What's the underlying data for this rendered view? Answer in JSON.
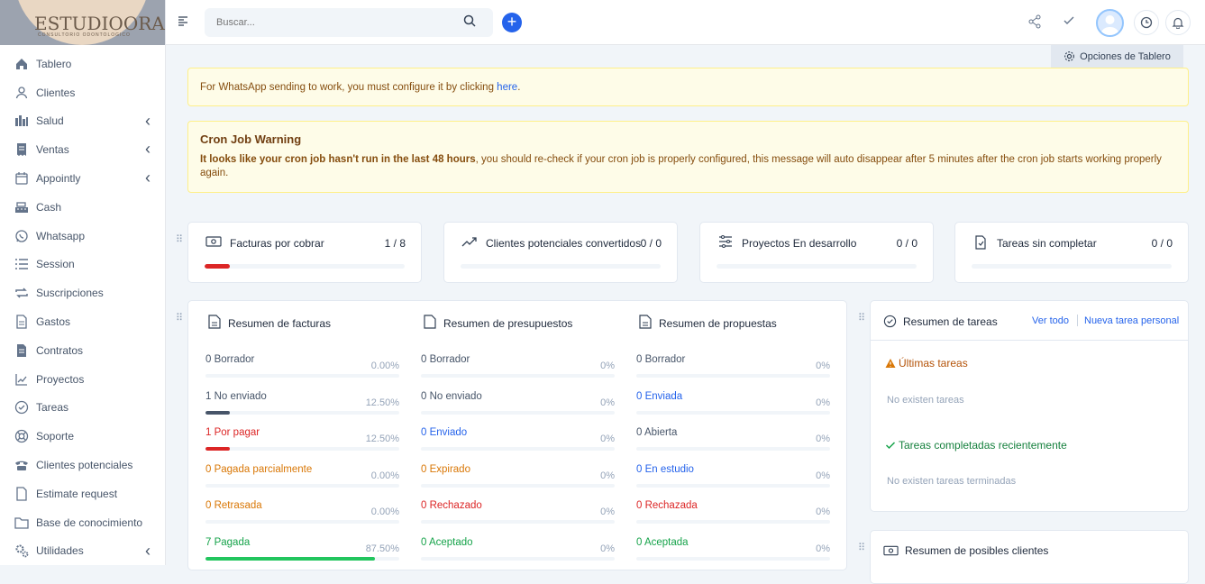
{
  "brand": {
    "logo_text": "ESTUDIOORAL",
    "logo_sub": "CONSULTORIO ODONTOLOGICO"
  },
  "sidebar": {
    "items": [
      {
        "label": "Tablero",
        "icon": "home-icon",
        "chev": false
      },
      {
        "label": "Clientes",
        "icon": "user-icon",
        "chev": false
      },
      {
        "label": "Salud",
        "icon": "chart-icon",
        "chev": true
      },
      {
        "label": "Ventas",
        "icon": "receipt-icon",
        "chev": true
      },
      {
        "label": "Appointly",
        "icon": "calendar-icon",
        "chev": true
      },
      {
        "label": "Cash",
        "icon": "register-icon",
        "chev": false
      },
      {
        "label": "Whatsapp",
        "icon": "whatsapp-icon",
        "chev": false
      },
      {
        "label": "Session",
        "icon": "list-icon",
        "chev": false
      },
      {
        "label": "Suscripciones",
        "icon": "repeat-icon",
        "chev": false
      },
      {
        "label": "Gastos",
        "icon": "file-icon",
        "chev": false
      },
      {
        "label": "Contratos",
        "icon": "contract-icon",
        "chev": false
      },
      {
        "label": "Proyectos",
        "icon": "chart-line-icon",
        "chev": false
      },
      {
        "label": "Tareas",
        "icon": "check-circle-icon",
        "chev": false
      },
      {
        "label": "Soporte",
        "icon": "lifebuoy-icon",
        "chev": false
      },
      {
        "label": "Clientes potenciales",
        "icon": "phone-icon",
        "chev": false
      },
      {
        "label": "Estimate request",
        "icon": "document-icon",
        "chev": false
      },
      {
        "label": "Base de conocimiento",
        "icon": "folder-icon",
        "chev": false
      },
      {
        "label": "Utilidades",
        "icon": "cogs-icon",
        "chev": true
      }
    ]
  },
  "topbar": {
    "search_placeholder": "Buscar..."
  },
  "dashboard_options": "Opciones de Tablero",
  "whatsapp_alert": {
    "text": "For WhatsApp sending to work, you must configure it by clicking ",
    "link": "here",
    "end": "."
  },
  "cron_alert": {
    "title": "Cron Job Warning",
    "bold": "It looks like your cron job hasn't run in the last 48 hours",
    "text": ", you should re-check if your cron job is properly configured, this message will auto disappear after 5 minutes after the cron job starts working properly again."
  },
  "stats": [
    {
      "title": "Facturas por cobrar",
      "value": "1 / 8",
      "progress": 0.125,
      "color": "#dc2626"
    },
    {
      "title": "Clientes potenciales convertidos",
      "value": "0 / 0",
      "progress": 0,
      "color": "#2563eb"
    },
    {
      "title": "Proyectos En desarrollo",
      "value": "0 / 0",
      "progress": 0,
      "color": "#2563eb"
    },
    {
      "title": "Tareas sin completar",
      "value": "0 / 0",
      "progress": 0,
      "color": "#2563eb"
    }
  ],
  "summaries": [
    {
      "title": "Resumen de facturas",
      "rows": [
        {
          "label": "0 Borrador",
          "pct": "0.00%",
          "color": "#475569",
          "progress": 0,
          "fill": "#475569"
        },
        {
          "label": "1 No enviado",
          "pct": "12.50%",
          "color": "#475569",
          "progress": 0.125,
          "fill": "#475569"
        },
        {
          "label": "1 Por pagar",
          "pct": "12.50%",
          "color": "#dc2626",
          "progress": 0.125,
          "fill": "#dc2626"
        },
        {
          "label": "0 Pagada parcialmente",
          "pct": "0.00%",
          "color": "#d97706",
          "progress": 0,
          "fill": "#d97706"
        },
        {
          "label": "0 Retrasada",
          "pct": "0.00%",
          "color": "#d97706",
          "progress": 0,
          "fill": "#d97706"
        },
        {
          "label": "7 Pagada",
          "pct": "87.50%",
          "color": "#16a34a",
          "progress": 0.875,
          "fill": "#22c55e"
        }
      ]
    },
    {
      "title": "Resumen de presupuestos",
      "rows": [
        {
          "label": "0 Borrador",
          "pct": "0%",
          "color": "#475569",
          "progress": 0,
          "fill": "#475569"
        },
        {
          "label": "0 No enviado",
          "pct": "0%",
          "color": "#475569",
          "progress": 0,
          "fill": "#475569"
        },
        {
          "label": "0 Enviado",
          "pct": "0%",
          "color": "#2563eb",
          "progress": 0,
          "fill": "#2563eb"
        },
        {
          "label": "0 Expirado",
          "pct": "0%",
          "color": "#d97706",
          "progress": 0,
          "fill": "#d97706"
        },
        {
          "label": "0 Rechazado",
          "pct": "0%",
          "color": "#dc2626",
          "progress": 0,
          "fill": "#dc2626"
        },
        {
          "label": "0 Aceptado",
          "pct": "0%",
          "color": "#16a34a",
          "progress": 0,
          "fill": "#16a34a"
        }
      ]
    },
    {
      "title": "Resumen de propuestas",
      "rows": [
        {
          "label": "0 Borrador",
          "pct": "0%",
          "color": "#475569",
          "progress": 0,
          "fill": "#475569"
        },
        {
          "label": "0 Enviada",
          "pct": "0%",
          "color": "#2563eb",
          "progress": 0,
          "fill": "#2563eb"
        },
        {
          "label": "0 Abierta",
          "pct": "0%",
          "color": "#475569",
          "progress": 0,
          "fill": "#475569"
        },
        {
          "label": "0 En estudio",
          "pct": "0%",
          "color": "#2563eb",
          "progress": 0,
          "fill": "#2563eb"
        },
        {
          "label": "0 Rechazada",
          "pct": "0%",
          "color": "#dc2626",
          "progress": 0,
          "fill": "#dc2626"
        },
        {
          "label": "0 Aceptada",
          "pct": "0%",
          "color": "#16a34a",
          "progress": 0,
          "fill": "#16a34a"
        }
      ]
    }
  ],
  "tasks": {
    "title": "Resumen de tareas",
    "view_all": "Ver todo",
    "new_task": "Nueva tarea personal",
    "latest": "Últimas tareas",
    "no_tasks": "No existen tareas",
    "completed": "Tareas completadas recientemente",
    "no_completed": "No existen tareas terminadas"
  },
  "leads_summary": {
    "title": "Resumen de posibles clientes"
  }
}
